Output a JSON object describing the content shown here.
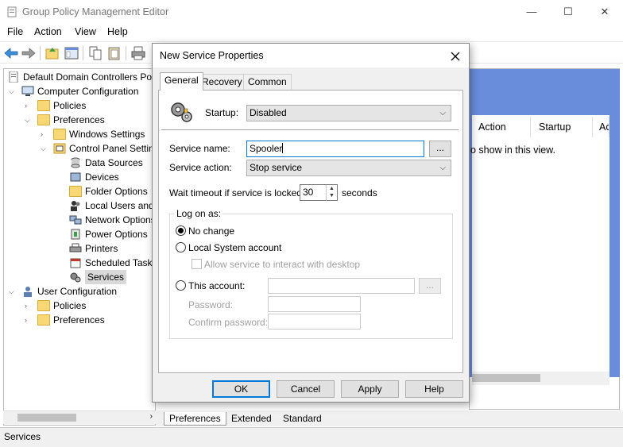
{
  "window": {
    "title": "Group Policy Management Editor",
    "minimize": "—",
    "maximize": "☐",
    "close": "✕"
  },
  "menu": {
    "file": "File",
    "action": "Action",
    "view": "View",
    "help": "Help"
  },
  "tree": {
    "root": "Default Domain Controllers Policy",
    "computer_config": "Computer Configuration",
    "policies": "Policies",
    "preferences": "Preferences",
    "windows_settings": "Windows Settings",
    "control_panel_settings": "Control Panel Settings",
    "data_sources": "Data Sources",
    "devices": "Devices",
    "folder_options": "Folder Options",
    "local_users": "Local Users and Groups",
    "network_options": "Network Options",
    "power_options": "Power Options",
    "printers": "Printers",
    "scheduled_tasks": "Scheduled Tasks",
    "services": "Services",
    "user_config": "User Configuration",
    "user_policies": "Policies",
    "user_preferences": "Preferences"
  },
  "right": {
    "columns": [
      "Action",
      "Startup",
      "Ac"
    ],
    "empty_message": "o show in this view."
  },
  "bottom_tabs": [
    "Preferences",
    "Extended",
    "Standard"
  ],
  "status": "Services",
  "dialog": {
    "title": "New Service Properties",
    "tabs": [
      "General",
      "Recovery",
      "Common"
    ],
    "startup_label": "Startup:",
    "startup_value": "Disabled",
    "service_name_label": "Service name:",
    "service_name_value": "Spooler",
    "browse_label": "...",
    "service_action_label": "Service action:",
    "service_action_value": "Stop service",
    "wait_label": "Wait timeout if service is locked:",
    "wait_value": "30",
    "seconds_label": "seconds",
    "logon_group": "Log on as:",
    "no_change": "No change",
    "local_system": "Local System account",
    "interact_desktop": "Allow service to interact with desktop",
    "this_account": "This account:",
    "account_browse": "...",
    "password_label": "Password:",
    "confirm_label": "Confirm password:",
    "ok": "OK",
    "cancel": "Cancel",
    "apply": "Apply",
    "help": "Help"
  },
  "colors": {
    "accent": "#0078d7",
    "panel_blue": "#6a8ddb",
    "folder": "#f8d775"
  }
}
